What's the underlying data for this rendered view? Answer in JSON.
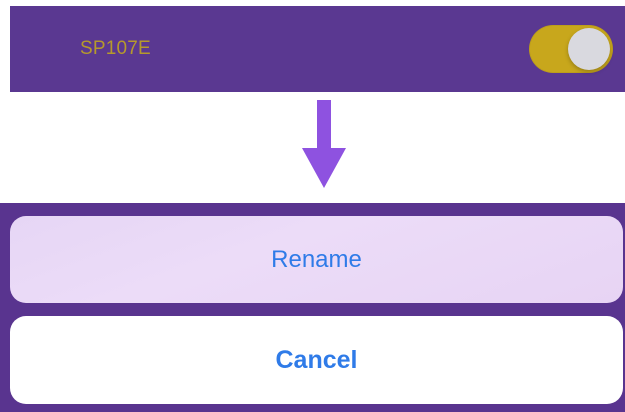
{
  "device_row": {
    "name": "SP107E",
    "toggle_on": true,
    "name_color": "#b69a2c",
    "background_color": "#5a3891",
    "toggle_color": "#c8a71c"
  },
  "arrow": {
    "icon": "arrow-down-icon",
    "color": "#8e52e0"
  },
  "action_sheet": {
    "rename_label": "Rename",
    "cancel_label": "Cancel",
    "background_color": "#59348f",
    "button_text_color": "#2f7be8"
  }
}
